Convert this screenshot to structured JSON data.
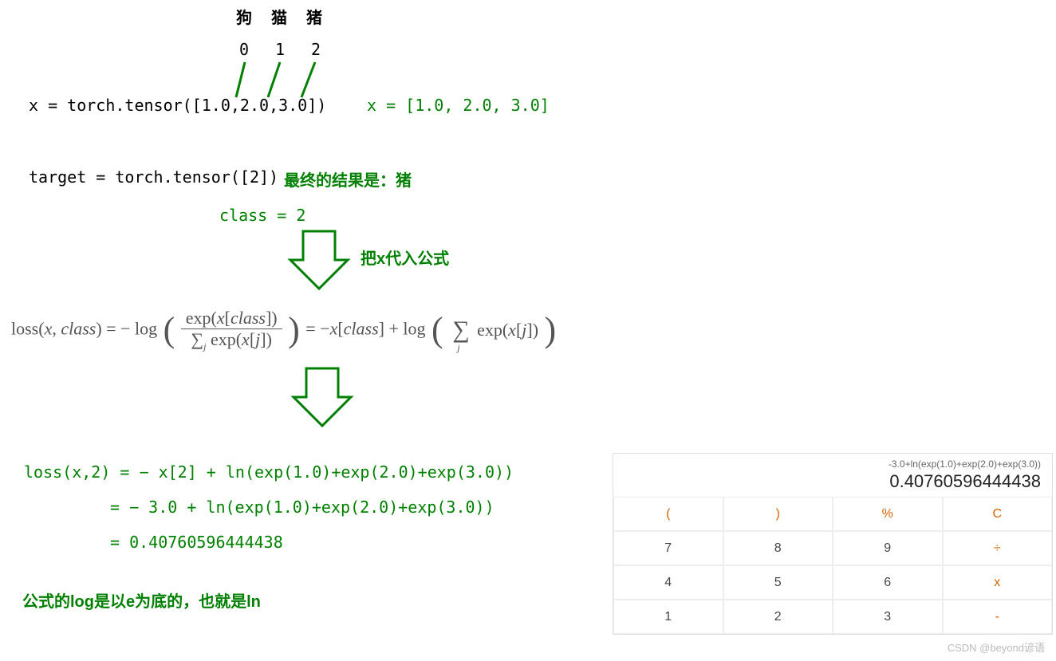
{
  "labels": {
    "dog": "狗",
    "cat": "猫",
    "pig": "猪",
    "idx0": "0",
    "idx1": "1",
    "idx2": "2"
  },
  "code": {
    "x_assign": "x = torch.tensor([1.0,2.0,3.0])",
    "x_list": "x = [1.0, 2.0, 3.0]",
    "target_assign": "target = torch.tensor([2])",
    "target_note": "最终的结果是：猪",
    "class_eq": "class = 2",
    "arrow1_note": "把x代入公式"
  },
  "formula_text": "loss(x, class) = − log ( exp(x[class]) / Σⱼ exp(x[j]) ) = −x[class] + log ( Σⱼ exp(x[j]) )",
  "calc_steps": {
    "l1": "loss(x,2) = − x[2] + ln(exp(1.0)+exp(2.0)+exp(3.0))",
    "l2": "= − 3.0  + ln(exp(1.0)+exp(2.0)+exp(3.0))",
    "l3": "= 0.40760596444438"
  },
  "footnote": "公式的log是以e为底的，也就是ln",
  "calculator": {
    "expr": "-3.0+ln(exp(1.0)+exp(2.0)+exp(3.0))",
    "result": "0.40760596444438",
    "keys": [
      [
        "(",
        ")",
        "%",
        "C"
      ],
      [
        "7",
        "8",
        "9",
        "÷"
      ],
      [
        "4",
        "5",
        "6",
        "x"
      ],
      [
        "1",
        "2",
        "3",
        "-"
      ]
    ],
    "op_keys": [
      "(",
      ")",
      "%",
      "C",
      "÷",
      "x",
      "-"
    ]
  },
  "watermark": "CSDN @beyond谚语"
}
